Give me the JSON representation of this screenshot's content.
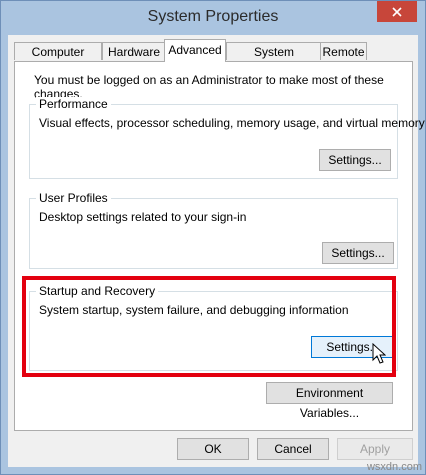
{
  "window": {
    "title": "System Properties"
  },
  "tabs": [
    "Computer Name",
    "Hardware",
    "Advanced",
    "System Protection",
    "Remote"
  ],
  "advanced": {
    "notice": "You must be logged on as an Administrator to make most of these changes.",
    "performance": {
      "title": "Performance",
      "description": "Visual effects, processor scheduling, memory usage, and virtual memory",
      "button": "Settings..."
    },
    "user_profiles": {
      "title": "User Profiles",
      "description": "Desktop settings related to your sign-in",
      "button": "Settings..."
    },
    "startup_recovery": {
      "title": "Startup and Recovery",
      "description": "System startup, system failure, and debugging information",
      "button": "Settings..."
    },
    "env_button": "Environment Variables..."
  },
  "footer": {
    "ok": "OK",
    "cancel": "Cancel",
    "apply": "Apply"
  },
  "watermark": "wsxdn.com",
  "colors": {
    "highlight": "#e3000f",
    "close": "#c7463a",
    "frame": "#aac4e0"
  }
}
